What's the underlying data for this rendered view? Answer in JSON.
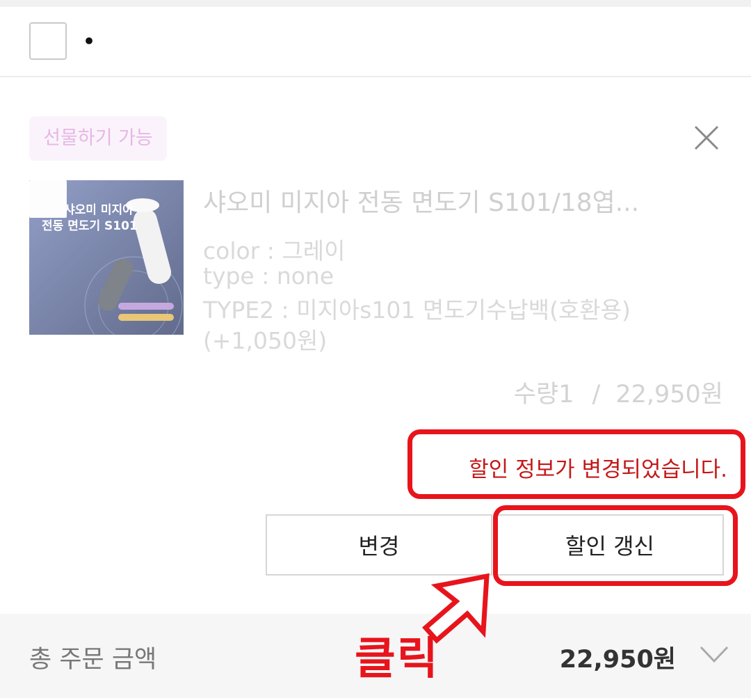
{
  "header": {
    "glyph": "•"
  },
  "item": {
    "gift_badge": "선물하기 가능",
    "title": "샤오미 미지아 전동 면도기 S101/18엽...",
    "thumbnail_lines": [
      "샤오미 미지아",
      "전동 면도기 S101"
    ],
    "options": [
      "color : 그레이",
      "type : none",
      "TYPE2 : 미지아s101 면도기수납백(호환용)",
      "(+1,050원)"
    ],
    "quantity": "수량1",
    "separator": "/",
    "price": "22,950원"
  },
  "notice": {
    "text": "할인 정보가 변경되었습니다."
  },
  "buttons": {
    "change_label": "변경",
    "refresh_label": "할인 갱신"
  },
  "annotation": {
    "click_label": "클릭"
  },
  "footer": {
    "label": "총 주문 금액",
    "total": "22,950원"
  },
  "colors": {
    "accent_red": "#e8141c",
    "notice_text": "#c41818",
    "badge_text": "#e6b7e6"
  }
}
